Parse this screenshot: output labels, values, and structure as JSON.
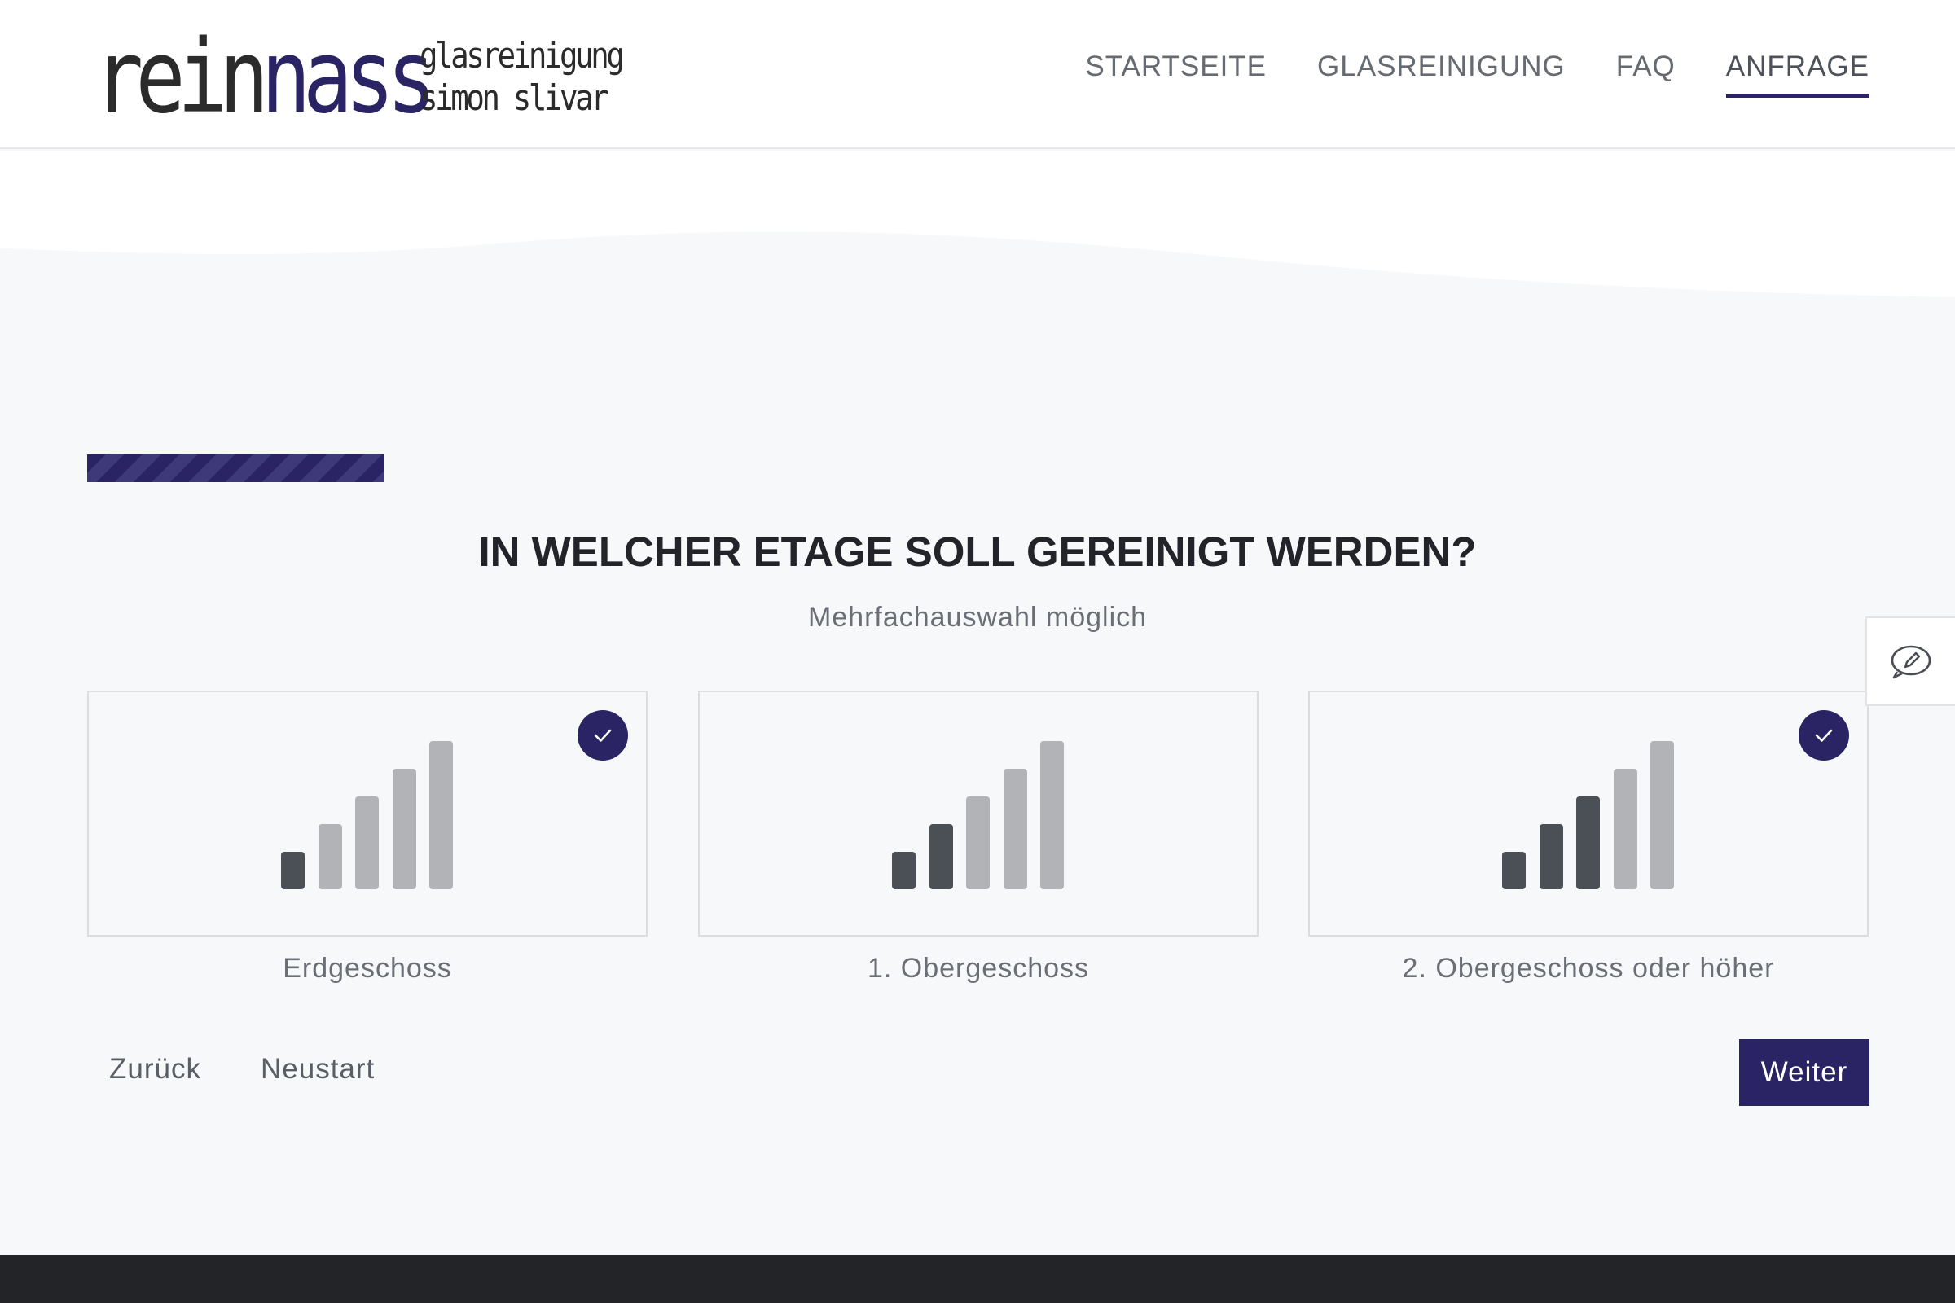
{
  "brand": {
    "name_part1": "re",
    "name_part2": "in",
    "name_part3": "nass",
    "tagline_line1": "glasreinigung",
    "tagline_line2": "simon slivar",
    "accent_color": "#2a2465"
  },
  "nav": {
    "items": [
      {
        "label": "STARTSEITE",
        "active": false
      },
      {
        "label": "GLASREINIGUNG",
        "active": false
      },
      {
        "label": "FAQ",
        "active": false
      },
      {
        "label": "ANFRAGE",
        "active": true
      }
    ]
  },
  "wizard": {
    "progress_fraction": 0.167,
    "question": "IN WELCHER ETAGE SOLL GEREINIGT WERDEN?",
    "hint": "Mehrfachauswahl möglich",
    "options": [
      {
        "label": "Erdgeschoss",
        "selected": true,
        "icon": "signal-level-1-icon",
        "highlighted_bars": 1
      },
      {
        "label": "1. Obergeschoss",
        "selected": false,
        "icon": "signal-level-2-icon",
        "highlighted_bars": 2
      },
      {
        "label": "2. Obergeschoss oder höher",
        "selected": true,
        "icon": "signal-level-3-icon",
        "highlighted_bars": 3
      }
    ],
    "back_label": "Zurück",
    "restart_label": "Neustart",
    "next_label": "Weiter"
  },
  "feedback": {
    "icon": "feedback-pencil-icon"
  }
}
